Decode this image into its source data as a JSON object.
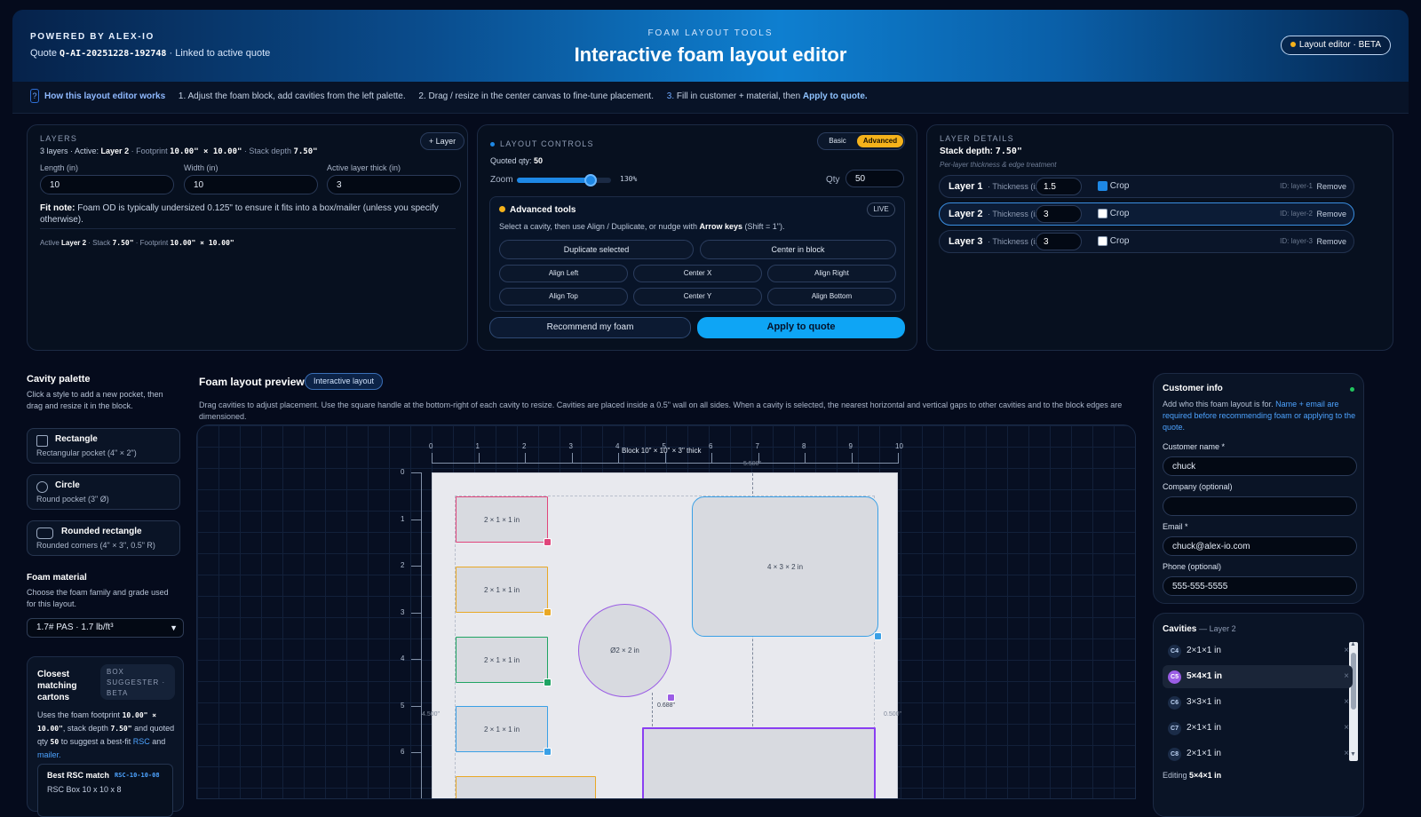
{
  "header": {
    "powered": "POWERED BY ALEX-IO",
    "quote_prefix": "Quote",
    "quote_id": "Q-AI-20251228-192748",
    "quote_suffix": "· Linked to active quote",
    "eyebrow": "FOAM LAYOUT TOOLS",
    "title": "Interactive foam layout editor",
    "badge": "Layout editor · BETA",
    "badge_color": "#f5b21b"
  },
  "help": {
    "icon": "?",
    "title": "How this layout editor works",
    "step1": "1. Adjust the foam block, add cavities from the left palette.",
    "step2": "2. Drag / resize in the center canvas to fine-tune placement.",
    "step3_prefix": "3.",
    "step3_text": "Fill in customer + material, then",
    "step3_link": "Apply to quote."
  },
  "layers": {
    "label": "LAYERS",
    "add_btn": "+ Layer",
    "summary_count": "3 layers · Active:",
    "summary_active": "Layer 2",
    "summary_fp_label": "· Footprint",
    "summary_fp": "10.00\" × 10.00\"",
    "summary_stack_label": "· Stack depth",
    "summary_stack": "7.50\"",
    "length_label": "Length (in)",
    "length": "10",
    "width_label": "Width (in)",
    "width": "10",
    "thick_label": "Active layer thick (in)",
    "thick": "3",
    "fit_title": "Fit note:",
    "fit_text": "Foam OD is typically undersized 0.125\" to ensure it fits into a box/mailer (unless you specify otherwise).",
    "foot_active_label": "Active",
    "foot_active": "Layer 2",
    "foot_stack_label": "· Stack",
    "foot_stack": "7.50\"",
    "foot_fp_label": "· Footprint",
    "foot_fp": "10.00\" × 10.00\""
  },
  "controls": {
    "label": "LAYOUT CONTROLS",
    "mode_basic": "Basic",
    "mode_advanced": "Advanced",
    "quoted_label": "Quoted qty:",
    "quoted_value": "50",
    "zoom_label": "Zoom",
    "zoom_value": "130%",
    "zoom_fraction": 0.78,
    "qty_label": "Qty",
    "qty_value": "50",
    "adv_title": "Advanced tools",
    "live": "LIVE",
    "adv_hint_pre": "Select a cavity, then use Align / Duplicate, or nudge with",
    "adv_hint_key": "Arrow keys",
    "adv_hint_post": "(Shift = 1\").",
    "duplicate": "Duplicate selected",
    "center_block": "Center in block",
    "align_left": "Align Left",
    "center_x": "Center X",
    "align_right": "Align Right",
    "align_top": "Align Top",
    "center_y": "Center Y",
    "align_bottom": "Align Bottom",
    "recommend": "Recommend my foam",
    "apply": "Apply to quote",
    "accent": "#0ea5f5"
  },
  "layer_details": {
    "label": "LAYER DETAILS",
    "stack_label": "Stack depth:",
    "stack_value": "7.50\"",
    "sub": "Per-layer thickness & edge treatment",
    "thickness_label": "· Thickness (in)",
    "crop": "Crop",
    "remove": "Remove",
    "rows": [
      {
        "name": "Layer 1",
        "thick": "1.5",
        "crop": true,
        "id": "ID: layer-1"
      },
      {
        "name": "Layer 2",
        "thick": "3",
        "crop": false,
        "id": "ID: layer-2"
      },
      {
        "name": "Layer 3",
        "thick": "3",
        "crop": false,
        "id": "ID: layer-3"
      }
    ]
  },
  "palette": {
    "title": "Cavity palette",
    "desc": "Click a style to add a new pocket, then drag and resize it in the block.",
    "items": [
      {
        "name": "Rectangle",
        "desc": "Rectangular pocket (4\" × 2\")"
      },
      {
        "name": "Circle",
        "desc": "Round pocket (3\" Ø)"
      },
      {
        "name": "Rounded rectangle",
        "desc": "Rounded corners (4\" × 3\", 0.5\" R)"
      }
    ],
    "material_title": "Foam material",
    "material_desc": "Choose the foam family and grade used for this layout.",
    "material_value": "1.7# PAS · 1.7 lb/ft³",
    "cartons_title": "Closest matching cartons",
    "cartons_badge": "BOX SUGGESTER · BETA",
    "cartons_t1": "Uses the foam footprint",
    "cartons_fp": "10.00\" × 10.00\"",
    "cartons_t2": ", stack depth",
    "cartons_stack": "7.50\"",
    "cartons_t3": "and quoted qty",
    "cartons_qty": "50",
    "cartons_t4": "to suggest a best-fit",
    "cartons_rsc": "RSC",
    "cartons_and": "and",
    "cartons_mailer": "mailer.",
    "rsc_title": "Best RSC match",
    "rsc_code": "RSC-10-10-08",
    "rsc_desc": "RSC Box 10 x 10 x 8"
  },
  "preview": {
    "title": "Foam layout preview",
    "pill": "Interactive layout",
    "desc": "Drag cavities to adjust placement. Use the square handle at the bottom-right of each cavity to resize. Cavities are placed inside a 0.5\" wall on all sides. When a cavity is selected, the nearest horizontal and vertical gaps to other cavities and to the block edges are dimensioned.",
    "block_label": "Block 10\" × 10\" × 3\" thick",
    "x_ticks": [
      "0",
      "1",
      "2",
      "3",
      "4",
      "5",
      "6",
      "7",
      "8",
      "9",
      "10"
    ],
    "y_ticks": [
      "0",
      "1",
      "2",
      "3",
      "4",
      "5",
      "6"
    ],
    "dim_top": "5.500\"",
    "dim_left": "4.500\"",
    "dim_right": "0.500\"",
    "dim_gap": "0.688\"",
    "cavities": [
      {
        "label": "2 × 1 × 1 in",
        "color": "#e0457b"
      },
      {
        "label": "2 × 1 × 1 in",
        "color": "#e9a825"
      },
      {
        "label": "2 × 1 × 1 in",
        "color": "#1fa463"
      },
      {
        "label": "2 × 1 × 1 in",
        "color": "#3aa0e6"
      },
      {
        "label": "Ø2 × 2 in",
        "color": "#9b5de5"
      },
      {
        "label": "4 × 3 × 2 in",
        "color": "#3aa0e6"
      },
      {
        "label": "",
        "color": "#8a3ff2"
      },
      {
        "label": "",
        "color": "#e9a825"
      }
    ]
  },
  "customer": {
    "title": "Customer info",
    "desc_pre": "Add who this foam layout is for.",
    "desc_link": "Name + email are required before recommending foam or applying to the quote.",
    "name_label": "Customer name *",
    "name": "chuck",
    "company_label": "Company (optional)",
    "company": "",
    "email_label": "Email *",
    "email": "chuck@alex-io.com",
    "phone_label": "Phone (optional)",
    "phone": "555-555-5555",
    "status_color": "#22c55e"
  },
  "cavities": {
    "title": "Cavities",
    "layer": "— Layer 2",
    "remove_glyph": "×",
    "items": [
      {
        "code": "C4",
        "label": "2×1×1 in"
      },
      {
        "code": "C5",
        "label": "5×4×1 in"
      },
      {
        "code": "C6",
        "label": "3×3×1 in"
      },
      {
        "code": "C7",
        "label": "2×1×1 in"
      },
      {
        "code": "C8",
        "label": "2×1×1 in"
      }
    ],
    "editing_label": "Editing",
    "editing_value": "5×4×1 in"
  }
}
